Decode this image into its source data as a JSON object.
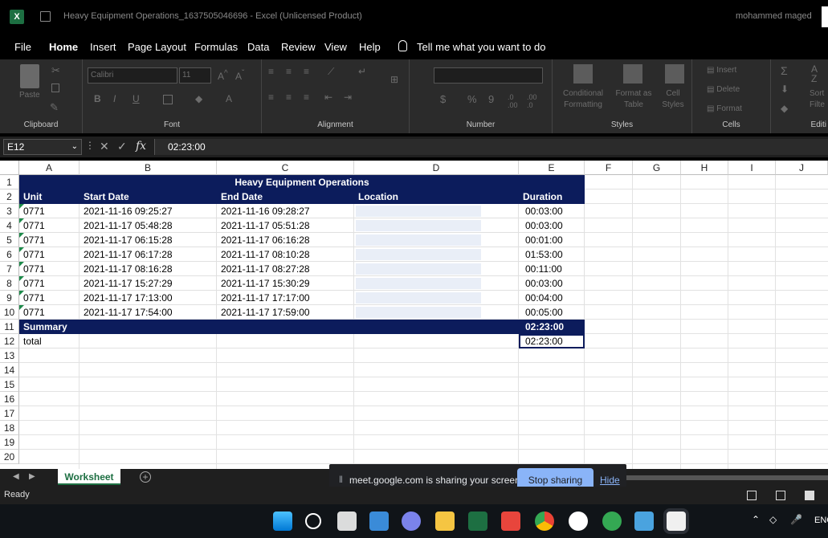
{
  "titlebar": {
    "document_title": "Heavy Equipment Operations_1637505046696",
    "separator": "-",
    "app_name": "Excel (Unlicensed Product)",
    "user": "mohammed maged"
  },
  "menu": [
    "File",
    "Home",
    "Insert",
    "Page Layout",
    "Formulas",
    "Data",
    "Review",
    "View",
    "Help"
  ],
  "tell_me": "Tell me what you want to do",
  "ribbon": {
    "groups": {
      "clipboard": "Clipboard",
      "font": "Font",
      "alignment": "Alignment",
      "number": "Number",
      "styles": "Styles",
      "cells": "Cells",
      "editing": "Editi"
    },
    "paste": "Paste",
    "font_name": "Calibri",
    "font_size": "11",
    "bold": "B",
    "italic": "I",
    "underline": "U",
    "dollar": "$",
    "percent": "%",
    "comma": "9",
    "conditional": "Conditional",
    "formatting": "Formatting",
    "format_as": "Format as",
    "table": "Table",
    "cell": "Cell",
    "styles_btn": "Styles",
    "insert": "Insert",
    "delete": "Delete",
    "format": "Format",
    "sort": "Sort",
    "filter": "Filte"
  },
  "formula_bar": {
    "name_box": "E12",
    "fx": "fx",
    "value": "02:23:00"
  },
  "columns": [
    "A",
    "B",
    "C",
    "D",
    "E",
    "F",
    "G",
    "H",
    "I",
    "J"
  ],
  "rows": [
    "1",
    "2",
    "3",
    "4",
    "5",
    "6",
    "7",
    "8",
    "9",
    "10",
    "11",
    "12",
    "13",
    "14",
    "15",
    "16",
    "17",
    "18",
    "19",
    "20"
  ],
  "sheet": {
    "title": "Heavy Equipment Operations",
    "headers": {
      "unit": "Unit",
      "start": "Start Date",
      "end": "End Date",
      "location": "Location",
      "duration": "Duration"
    },
    "data": [
      {
        "unit": "0771",
        "start": "2021-11-16 09:25:27",
        "end": "2021-11-16 09:28:27",
        "duration": "00:03:00"
      },
      {
        "unit": "0771",
        "start": "2021-11-17 05:48:28",
        "end": "2021-11-17 05:51:28",
        "duration": "00:03:00"
      },
      {
        "unit": "0771",
        "start": "2021-11-17 06:15:28",
        "end": "2021-11-17 06:16:28",
        "duration": "00:01:00"
      },
      {
        "unit": "0771",
        "start": "2021-11-17 06:17:28",
        "end": "2021-11-17 08:10:28",
        "duration": "01:53:00"
      },
      {
        "unit": "0771",
        "start": "2021-11-17 08:16:28",
        "end": "2021-11-17 08:27:28",
        "duration": "00:11:00"
      },
      {
        "unit": "0771",
        "start": "2021-11-17 15:27:29",
        "end": "2021-11-17 15:30:29",
        "duration": "00:03:00"
      },
      {
        "unit": "0771",
        "start": "2021-11-17 17:13:00",
        "end": "2021-11-17 17:17:00",
        "duration": "00:04:00"
      },
      {
        "unit": "0771",
        "start": "2021-11-17 17:54:00",
        "end": "2021-11-17 17:59:00",
        "duration": "00:05:00"
      }
    ],
    "summary_label": "Summary",
    "summary_value": "02:23:00",
    "total_label": "total",
    "total_value": "02:23:00"
  },
  "sheet_tab": "Worksheet",
  "share_banner": {
    "text": "meet.google.com is sharing your screen.",
    "stop": "Stop sharing",
    "hide": "Hide"
  },
  "status": "Ready",
  "taskbar_lang": "ENG",
  "colors": {
    "navy": "#0c1c5c",
    "excel_green": "#1d6f42",
    "stop_btn": "#8ab4f8"
  }
}
